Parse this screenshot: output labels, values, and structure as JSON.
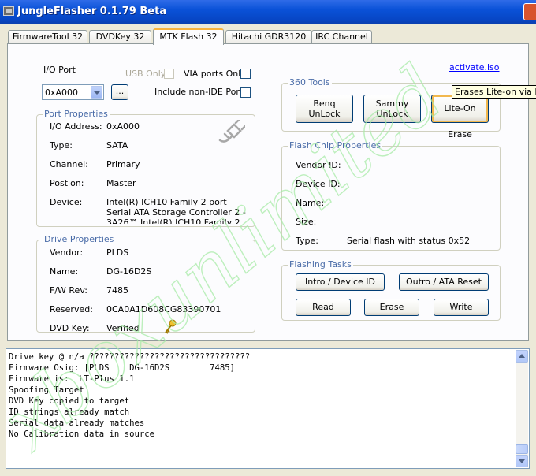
{
  "window": {
    "title": "JungleFlasher 0.1.79 Beta"
  },
  "tabs": [
    "FirmwareTool 32",
    "DVDKey 32",
    "MTK Flash 32",
    "Hitachi GDR3120",
    "IRC Channel"
  ],
  "active_tab": "MTK Flash 32",
  "io_port": {
    "label": "I/O Port",
    "value": "0xA000",
    "browse_label": "...",
    "usb_only_label": "USB Only",
    "via_ports_only_label": "VIA ports Only",
    "include_non_ide_label": "Include non-IDE Ports"
  },
  "activate_link": "activate.iso",
  "port_properties": {
    "title": "Port Properties",
    "rows": [
      {
        "label": "I/O Address:",
        "value": "0xA000"
      },
      {
        "label": "Type:",
        "value": "SATA"
      },
      {
        "label": "Channel:",
        "value": "Primary"
      },
      {
        "label": "Postion:",
        "value": "Master"
      }
    ],
    "device_label": "Device:",
    "device_lines": [
      "Intel(R) ICH10 Family 2 port",
      "Serial ATA Storage Controller 2 -",
      "3A26™ Intel(R) ICH10 Family 2"
    ]
  },
  "drive_properties": {
    "title": "Drive Properties",
    "rows": [
      {
        "label": "Vendor:",
        "value": "PLDS"
      },
      {
        "label": "Name:",
        "value": "DG-16D2S"
      },
      {
        "label": "F/W Rev:",
        "value": "7485"
      },
      {
        "label": "Reserved:",
        "value": "0CA0A1D608CG83390701"
      },
      {
        "label": "DVD Key:",
        "value": "Verified"
      }
    ]
  },
  "tools_360": {
    "title": "360 Tools",
    "benq": [
      "Benq",
      "UnLock"
    ],
    "sammy": [
      "Sammy",
      "UnLock"
    ],
    "liteon": "Lite-On Erase",
    "tooltip": "Erases Lite-on via In"
  },
  "flash_chip": {
    "title": "Flash Chip Properties",
    "rows": [
      {
        "label": "Vendor ID:",
        "value": ""
      },
      {
        "label": "Device ID:",
        "value": ""
      },
      {
        "label": "Name:",
        "value": ""
      },
      {
        "label": "Size:",
        "value": ""
      },
      {
        "label": "Type:",
        "value": "Serial flash with status 0x52"
      }
    ]
  },
  "flashing_tasks": {
    "title": "Flashing Tasks",
    "intro": "Intro / Device ID",
    "outro": "Outro / ATA Reset",
    "read": "Read",
    "erase": "Erase",
    "write": "Write"
  },
  "log_lines": [
    "Drive key @ n/a ????????????????????????????????",
    "Firmware Osig: [PLDS    DG-16D2S        7485]",
    "Firmware is:  LT-Plus 1.1",
    "Spoofing Target",
    "DVD Key copied to target",
    "ID strings already match",
    "Serial data already matches",
    "No Calibration data in source"
  ],
  "watermark_text": "xboxunlimited",
  "colors": {
    "title_bar": "#0A52D8",
    "group_title": "#4A6CA8",
    "tab_highlight": "#F9B33C",
    "watermark": "#A8EBA8",
    "link": "#0000FF"
  }
}
